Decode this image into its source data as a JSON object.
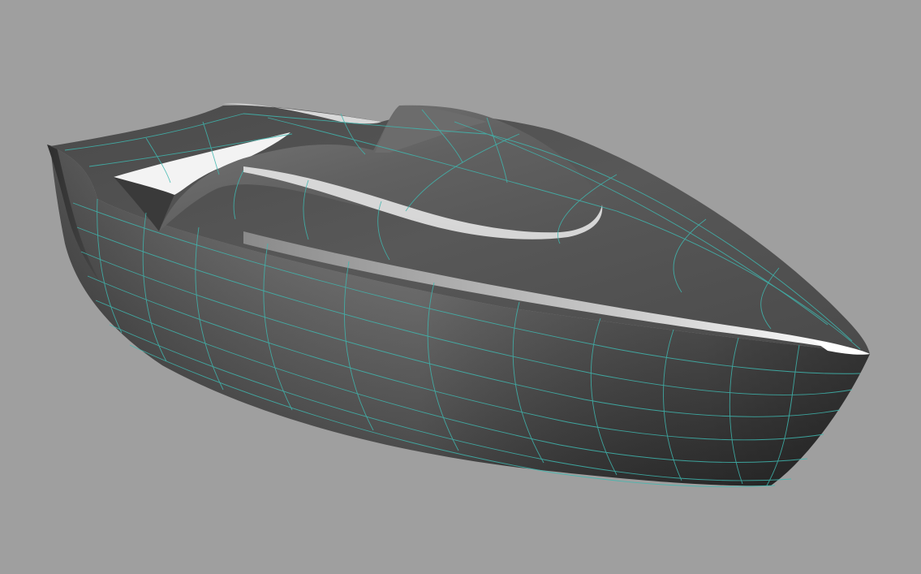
{
  "viewport": {
    "background": "#9f9f9f",
    "model": "boat-hull",
    "render_mode": "shaded-with-wireframe",
    "colors": {
      "hull_dark": "#3a3a3a",
      "hull_mid": "#5c5c5c",
      "hull_light": "#8a8a8a",
      "highlight": "#f2f2f2",
      "wireframe": "#3fb8b0"
    }
  }
}
